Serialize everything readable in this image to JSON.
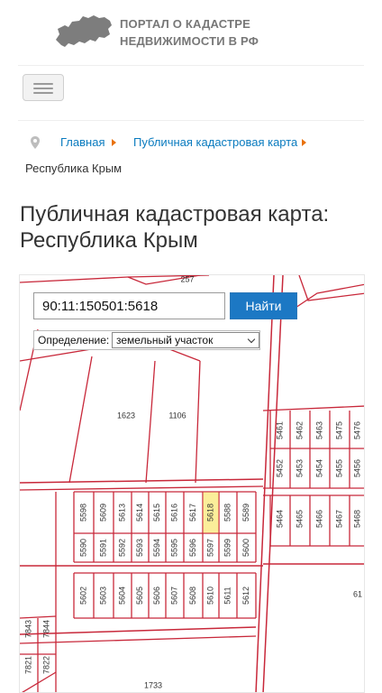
{
  "header": {
    "logo_line1": "ПОРТАЛ О КАДАСТРЕ",
    "logo_line2": "НЕДВИЖИМОСТИ В РФ",
    "logo_icon": "russia-map-icon"
  },
  "menu": {
    "icon": "hamburger-icon"
  },
  "breadcrumb": {
    "icon": "location-pin-icon",
    "items": [
      "Главная",
      "Публичная кадастровая карта"
    ],
    "current": "Республика Крым"
  },
  "page": {
    "title_line1": "Публичная кадастровая карта:",
    "title_line2": "Республика Крым"
  },
  "search": {
    "value": "90:11:150501:5618",
    "button_label": "Найти"
  },
  "definition": {
    "label": "Определение:",
    "selected": "земельный участок"
  },
  "map": {
    "highlight_color": "#fbee9a",
    "line_color": "#c8283a",
    "parcels": {
      "top": "257",
      "area_1623": "1623",
      "area_1106": "1106",
      "area_1733": "1733",
      "area_61": "61",
      "row1": [
        "5598",
        "5609",
        "5613",
        "5614",
        "5615",
        "5616",
        "5617",
        "5618",
        "5588",
        "5589"
      ],
      "row2": [
        "5590",
        "5591",
        "5592",
        "5593",
        "5594",
        "5595",
        "5596",
        "5597",
        "5599",
        "5600"
      ],
      "row3": [
        "5602",
        "5603",
        "5604",
        "5605",
        "5606",
        "5607",
        "5608",
        "5610",
        "5611",
        "5612"
      ],
      "right_top": [
        "5461",
        "5462",
        "5463",
        "5475",
        "5476"
      ],
      "right_mid": [
        "5452",
        "5453",
        "5454",
        "5455",
        "5456"
      ],
      "right_low": [
        "5464",
        "5465",
        "5466",
        "5467",
        "5468"
      ],
      "left": [
        "7843",
        "7844",
        "7821",
        "7822"
      ]
    }
  }
}
